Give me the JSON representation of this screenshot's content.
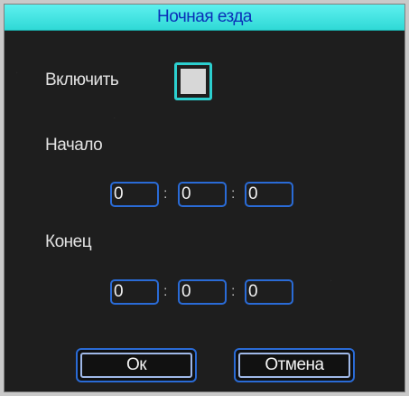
{
  "dialog": {
    "title": "Ночная езда",
    "enable_label": "Включить",
    "enable_checked": false,
    "start_label": "Начало",
    "start_time": {
      "hour": "0",
      "minute": "0",
      "second": "0"
    },
    "end_label": "Конец",
    "end_time": {
      "hour": "0",
      "minute": "0",
      "second": "0"
    },
    "separator": ":",
    "ok_label": "Ок",
    "cancel_label": "Отмена"
  },
  "colors": {
    "title_background": "#2fd9d6",
    "title_text": "#0a2fb8",
    "field_border": "#2a6bd6",
    "checkbox_border": "#2ccfcf",
    "panel_background": "#1e1e1e"
  }
}
